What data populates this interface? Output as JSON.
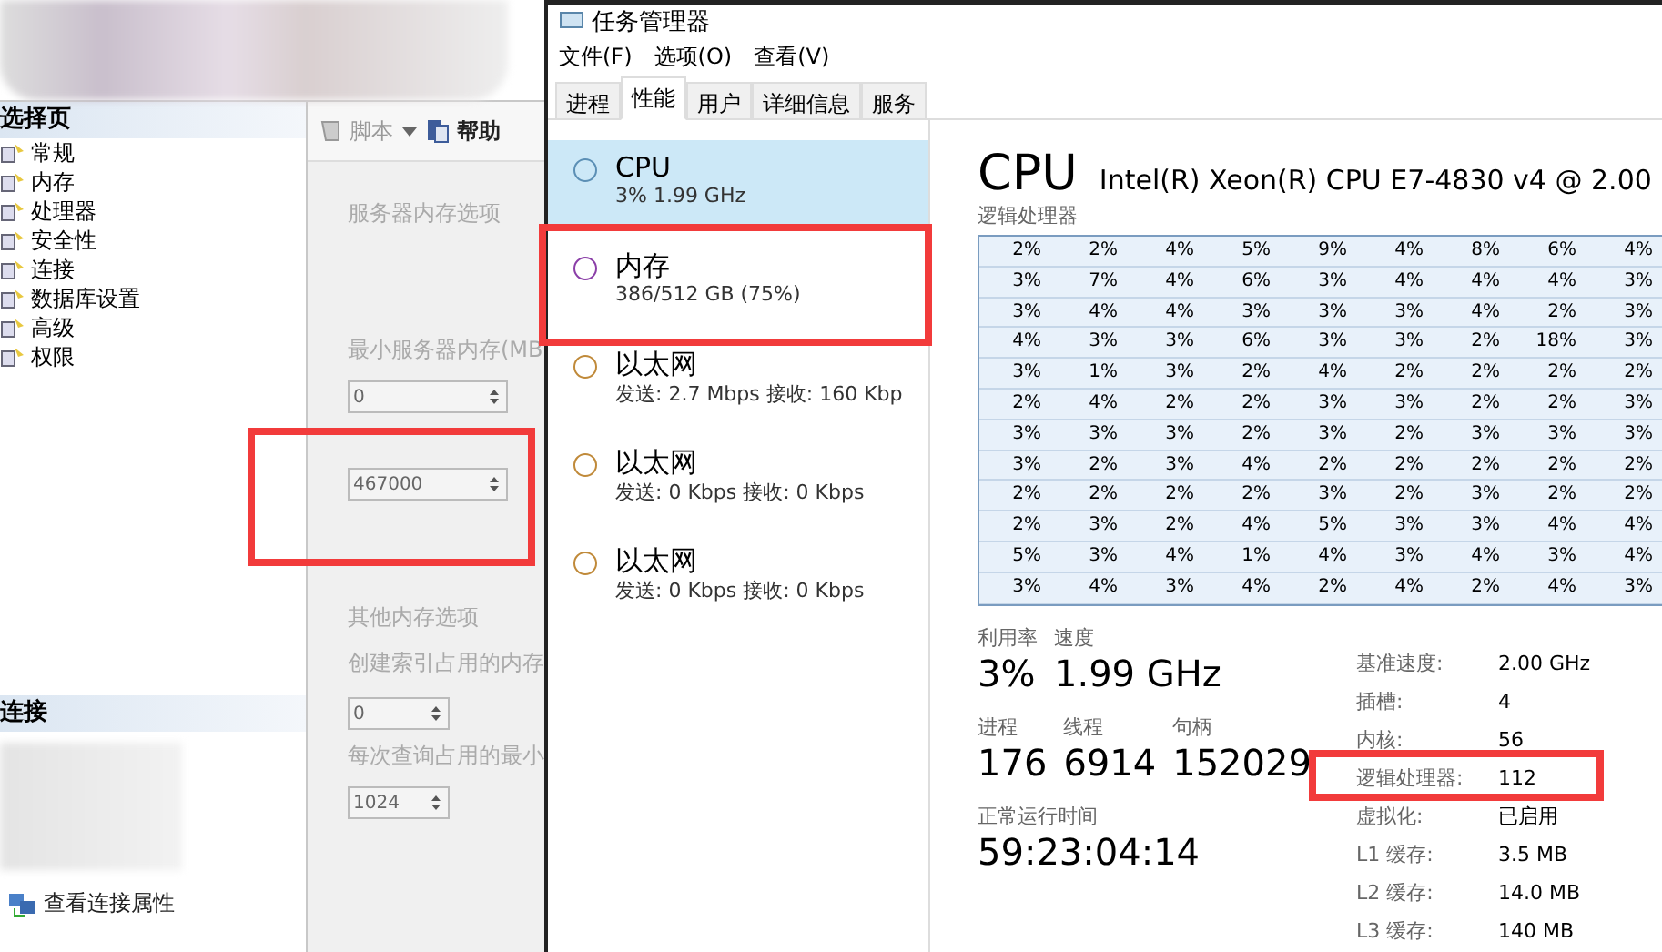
{
  "config_window": {
    "sidebar": {
      "header": "选择页",
      "items": [
        {
          "label": "常规",
          "selected": false
        },
        {
          "label": "内存",
          "selected": false
        },
        {
          "label": "处理器",
          "selected": false
        },
        {
          "label": "安全性",
          "selected": false
        },
        {
          "label": "连接",
          "selected": false
        },
        {
          "label": "数据库设置",
          "selected": false
        },
        {
          "label": "高级",
          "selected": false
        },
        {
          "label": "权限",
          "selected": false
        }
      ],
      "connection_header": "连接",
      "connection_link": "查看连接属性"
    },
    "toolbar": {
      "script": "脚本",
      "help": "帮助"
    },
    "memory": {
      "section": "服务器内存选项",
      "min_label": "最小服务器内存(MB",
      "min_value": "0",
      "max_value": "467000",
      "other_section": "其他内存选项",
      "index_label": "创建索引占用的内存",
      "index_value": "0",
      "query_label": "每次查询占用的最小",
      "query_value": "1024"
    }
  },
  "task_manager": {
    "title": "任务管理器",
    "menu": [
      "文件(F)",
      "选项(O)",
      "查看(V)"
    ],
    "tabs": [
      {
        "label": "进程",
        "selected": false
      },
      {
        "label": "性能",
        "selected": true
      },
      {
        "label": "用户",
        "selected": false
      },
      {
        "label": "详细信息",
        "selected": false
      },
      {
        "label": "服务",
        "selected": false
      }
    ],
    "resources": [
      {
        "name": "CPU",
        "detail": "3% 1.99 GHz",
        "selected": true,
        "color": "#5b8fb5"
      },
      {
        "name": "内存",
        "detail": "386/512 GB (75%)",
        "selected": false,
        "color": "#8b3fa8"
      },
      {
        "name": "以太网",
        "detail": "发送: 2.7 Mbps 接收: 160 Kbp",
        "selected": false,
        "color": "#c08a3a"
      },
      {
        "name": "以太网",
        "detail": "发送: 0 Kbps 接收: 0 Kbps",
        "selected": false,
        "color": "#c08a3a"
      },
      {
        "name": "以太网",
        "detail": "发送: 0 Kbps 接收: 0 Kbps",
        "selected": false,
        "color": "#c08a3a"
      }
    ],
    "detail": {
      "title": "CPU",
      "model": "Intel(R) Xeon(R) CPU E7-4830 v4 @ 2.00",
      "grid_label": "逻辑处理器",
      "grid": [
        [
          "2%",
          "2%",
          "4%",
          "5%",
          "9%",
          "4%",
          "8%",
          "6%",
          "4%"
        ],
        [
          "3%",
          "7%",
          "4%",
          "6%",
          "3%",
          "4%",
          "4%",
          "4%",
          "3%"
        ],
        [
          "3%",
          "4%",
          "4%",
          "3%",
          "3%",
          "3%",
          "4%",
          "2%",
          "3%"
        ],
        [
          "4%",
          "3%",
          "3%",
          "6%",
          "3%",
          "3%",
          "2%",
          "18%",
          "3%"
        ],
        [
          "3%",
          "1%",
          "3%",
          "2%",
          "4%",
          "2%",
          "2%",
          "2%",
          "2%"
        ],
        [
          "2%",
          "4%",
          "2%",
          "2%",
          "3%",
          "3%",
          "2%",
          "2%",
          "3%"
        ],
        [
          "3%",
          "3%",
          "3%",
          "2%",
          "3%",
          "2%",
          "3%",
          "3%",
          "3%"
        ],
        [
          "3%",
          "2%",
          "3%",
          "4%",
          "2%",
          "2%",
          "2%",
          "2%",
          "2%"
        ],
        [
          "2%",
          "2%",
          "2%",
          "2%",
          "3%",
          "2%",
          "3%",
          "2%",
          "2%"
        ],
        [
          "2%",
          "3%",
          "2%",
          "4%",
          "5%",
          "3%",
          "3%",
          "4%",
          "4%"
        ],
        [
          "5%",
          "3%",
          "4%",
          "1%",
          "4%",
          "3%",
          "4%",
          "3%",
          "4%"
        ],
        [
          "3%",
          "4%",
          "3%",
          "4%",
          "2%",
          "4%",
          "2%",
          "4%",
          "3%"
        ]
      ],
      "stats": [
        [
          {
            "label": "利用率",
            "value": "3%"
          },
          {
            "label": "速度",
            "value": "1.99 GHz"
          }
        ],
        [
          {
            "label": "进程",
            "value": "176"
          },
          {
            "label": "线程",
            "value": "6914"
          },
          {
            "label": "句柄",
            "value": "152029"
          }
        ],
        [
          {
            "label": "正常运行时间",
            "value": "59:23:04:14"
          }
        ]
      ],
      "specs": [
        {
          "label": "基准速度:",
          "value": "2.00 GHz"
        },
        {
          "label": "插槽:",
          "value": "4"
        },
        {
          "label": "内核:",
          "value": "56"
        },
        {
          "label": "逻辑处理器:",
          "value": "112"
        },
        {
          "label": "虚拟化:",
          "value": "已启用"
        },
        {
          "label": "L1 缓存:",
          "value": "3.5 MB"
        },
        {
          "label": "L2 缓存:",
          "value": "14.0 MB"
        },
        {
          "label": "L3 缓存:",
          "value": "140 MB"
        }
      ]
    }
  }
}
